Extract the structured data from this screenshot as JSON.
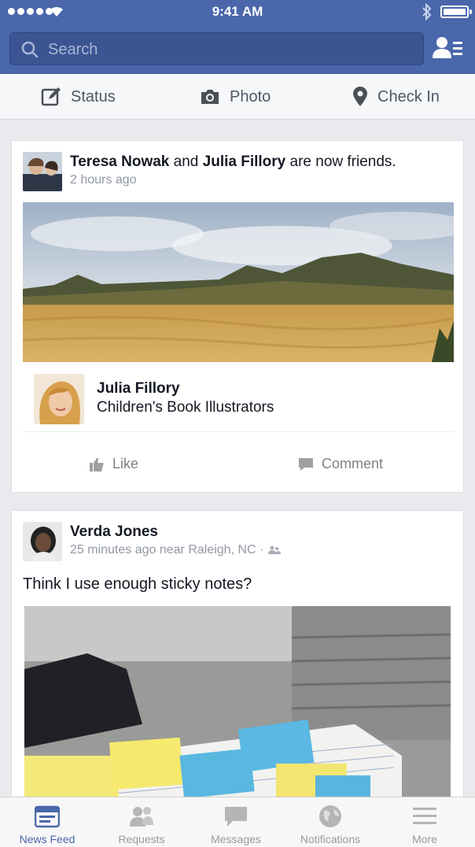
{
  "status_bar": {
    "time": "9:41 AM"
  },
  "search": {
    "placeholder": "Search"
  },
  "composer": {
    "status_label": "Status",
    "photo_label": "Photo",
    "checkin_label": "Check In"
  },
  "feed": [
    {
      "actor1": "Teresa Nowak",
      "conj": "and",
      "actor2": "Julia Fillory",
      "verb": "are now friends.",
      "time": "2 hours ago",
      "friend_name": "Julia Fillory",
      "friend_subtitle": "Children's Book Illustrators",
      "like_label": "Like",
      "comment_label": "Comment"
    },
    {
      "author": "Verda Jones",
      "meta": "25 minutes ago near Raleigh, NC ·",
      "text": "Think I use enough sticky notes?"
    }
  ],
  "tabbar": {
    "items": [
      {
        "label": "News Feed",
        "icon": "news-feed-icon",
        "active": true
      },
      {
        "label": "Requests",
        "icon": "friend-requests-icon"
      },
      {
        "label": "Messages",
        "icon": "messages-icon"
      },
      {
        "label": "Notifications",
        "icon": "globe-icon"
      },
      {
        "label": "More",
        "icon": "hamburger-icon"
      }
    ]
  },
  "colors": {
    "brand": "#4a67ac",
    "tab_active": "#4a67ac",
    "tab_inactive": "#9a9a9a"
  }
}
